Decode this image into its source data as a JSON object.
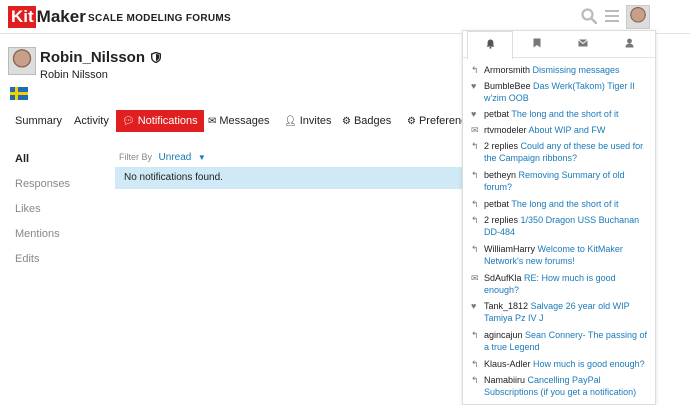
{
  "header": {
    "logo_kit": "Kit",
    "logo_maker": "Maker",
    "subtitle": "SCALE MODELING FORUMS",
    "icons": [
      "search-icon",
      "menu-icon",
      "avatar"
    ]
  },
  "profile": {
    "username": "Robin_Nilsson",
    "display_name": "Robin Nilsson",
    "badge_icon": "shield-icon",
    "flag": "sweden-flag"
  },
  "tabs": [
    {
      "label": "Summary"
    },
    {
      "label": "Activity"
    },
    {
      "label": "Notifications",
      "icon": "chat-bubble-icon"
    },
    {
      "label": "Messages",
      "icon": "envelope-icon"
    },
    {
      "label": "Invites",
      "icon": "add-user-icon"
    },
    {
      "label": "Badges",
      "icon": "gear-badge-icon"
    },
    {
      "label": "Preferences",
      "icon": "gear-icon"
    }
  ],
  "sidenav": [
    "All",
    "Responses",
    "Likes",
    "Mentions",
    "Edits"
  ],
  "filter": {
    "label": "Filter By",
    "value": "Unread"
  },
  "empty_message": "No notifications found.",
  "panel": {
    "tabs": [
      "bell-icon",
      "bookmark-icon",
      "envelope-icon",
      "user-icon"
    ],
    "items": [
      {
        "icon": "reply-icon",
        "who": "Armorsmith",
        "text": "Dismissing messages"
      },
      {
        "icon": "heart-icon",
        "who": "BumbleBee",
        "text": "Das Werk(Takom) Tiger II w'zim OOB"
      },
      {
        "icon": "heart-icon",
        "who": "petbat",
        "text": "The long and the short of it"
      },
      {
        "icon": "envelope-icon",
        "who": "rtvmodeler",
        "text": "About WIP and FW"
      },
      {
        "icon": "reply-icon",
        "who": "2 replies",
        "text": "Could any of these be used for the Campaign ribbons?"
      },
      {
        "icon": "reply-icon",
        "who": "betheyn",
        "text": "Removing Summary of old forum?"
      },
      {
        "icon": "reply-icon",
        "who": "petbat",
        "text": "The long and the short of it"
      },
      {
        "icon": "reply-icon",
        "who": "2 replies",
        "text": "1/350 Dragon USS Buchanan DD-484"
      },
      {
        "icon": "reply-icon",
        "who": "WilliamHarry",
        "text": "Welcome to KitMaker Network's new forums!"
      },
      {
        "icon": "envelope-icon",
        "who": "SdAufKla",
        "text": "RE: How much is good enough?"
      },
      {
        "icon": "heart-icon",
        "who": "Tank_1812",
        "text": "Salvage 26 year old WIP Tamiya Pz IV J"
      },
      {
        "icon": "reply-icon",
        "who": "agincajun",
        "text": "Sean Connery- The passing of a true Legend"
      },
      {
        "icon": "reply-icon",
        "who": "Klaus-Adler",
        "text": "How much is good enough?"
      },
      {
        "icon": "reply-icon",
        "who": "Namabiiru",
        "text": "Cancelling PayPal Subscriptions (if you get a notification)"
      }
    ]
  }
}
